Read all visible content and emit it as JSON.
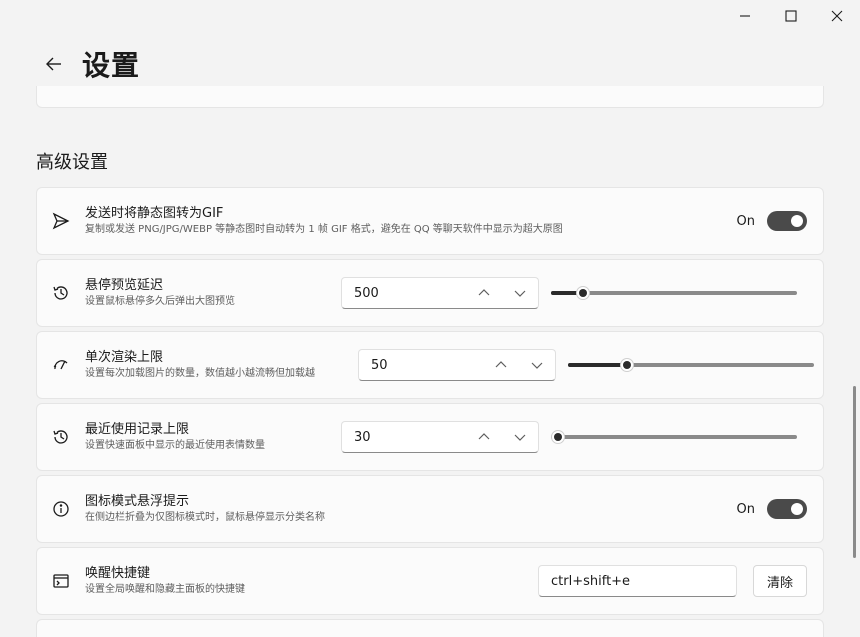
{
  "window": {
    "minimize_icon": "minimize-icon",
    "maximize_icon": "maximize-icon",
    "close_icon": "close-icon"
  },
  "header": {
    "back_icon": "arrow-left-icon",
    "title": "设置"
  },
  "section": {
    "title": "高级设置"
  },
  "settings": {
    "gif": {
      "icon": "send-icon",
      "title": "发送时将静态图转为GIF",
      "desc": "复制或发送 PNG/JPG/WEBP 等静态图时自动转为 1 帧 GIF 格式，避免在 QQ 等聊天软件中显示为超大原图",
      "toggle_label": "On",
      "on": true
    },
    "hover_delay": {
      "icon": "history-icon",
      "title": "悬停预览延迟",
      "desc": "设置鼠标悬停多久后弹出大图预览",
      "value": "500",
      "slider_fraction": 0.13
    },
    "render_limit": {
      "icon": "speed-icon",
      "title": "单次渲染上限",
      "desc": "设置每次加载图片的数量，数值越小越流畅但加载越",
      "value": "50",
      "slider_fraction": 0.24
    },
    "recent_limit": {
      "icon": "history-icon",
      "title": "最近使用记录上限",
      "desc": "设置快速面板中显示的最近使用表情数量",
      "value": "30",
      "slider_fraction": 0.0
    },
    "tooltip": {
      "icon": "info-icon",
      "title": "图标模式悬浮提示",
      "desc": "在侧边栏折叠为仅图标模式时，鼠标悬停显示分类名称",
      "toggle_label": "On",
      "on": true
    },
    "hotkey": {
      "icon": "terminal-icon",
      "title": "唤醒快捷键",
      "desc": "设置全局唤醒和隐藏主面板的快捷键",
      "value": "ctrl+shift+e",
      "clear_label": "清除"
    }
  }
}
